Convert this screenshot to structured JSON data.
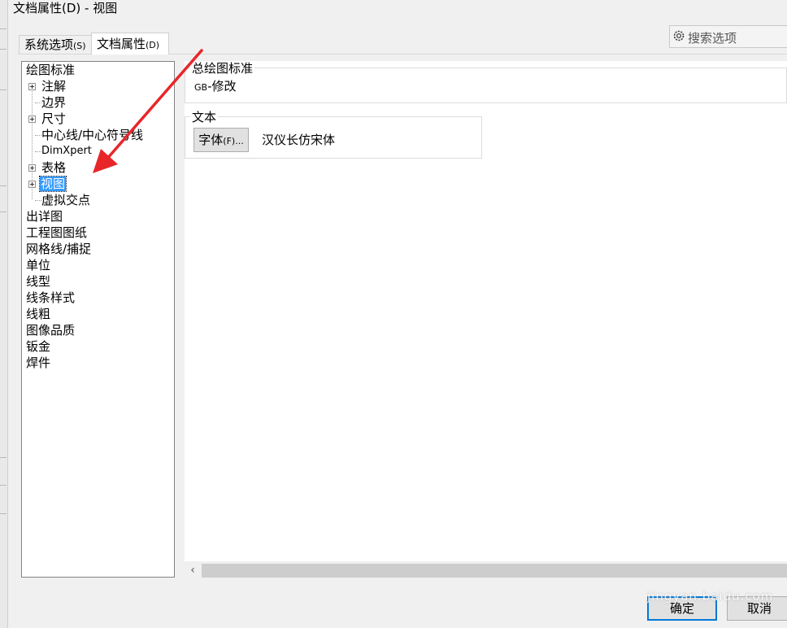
{
  "window": {
    "title": "文档属性(D) - 视图"
  },
  "tabs": [
    {
      "label": "系统选项",
      "accel": "(S)"
    },
    {
      "label": "文档属性",
      "accel": "(D)"
    }
  ],
  "search": {
    "placeholder": "搜索选项"
  },
  "tree": [
    {
      "label": "绘图标准"
    },
    {
      "label": "注解"
    },
    {
      "label": "边界"
    },
    {
      "label": "尺寸"
    },
    {
      "label": "中心线/中心符号线"
    },
    {
      "label": "DimXpert"
    },
    {
      "label": "表格"
    },
    {
      "label": "视图"
    },
    {
      "label": "虚拟交点"
    },
    {
      "label": "出详图"
    },
    {
      "label": "工程图图纸"
    },
    {
      "label": "网格线/捕捉"
    },
    {
      "label": "单位"
    },
    {
      "label": "线型"
    },
    {
      "label": "线条样式"
    },
    {
      "label": "线粗"
    },
    {
      "label": "图像品质"
    },
    {
      "label": "钣金"
    },
    {
      "label": "焊件"
    }
  ],
  "overall_standard": {
    "label": "总绘图标准",
    "prefix": "GB",
    "value": "-修改"
  },
  "text_section": {
    "label": "文本",
    "font_button": "字体",
    "font_button_accel": "(F)...",
    "font_name": "汉仪长仿宋体"
  },
  "buttons": {
    "ok": "确定",
    "cancel": "取消"
  },
  "watermark": "jingyan.baidu.com",
  "colors": {
    "selection": "#3399ff",
    "annotation_arrow": "#e8262a",
    "default_button_border": "#0078d7"
  }
}
